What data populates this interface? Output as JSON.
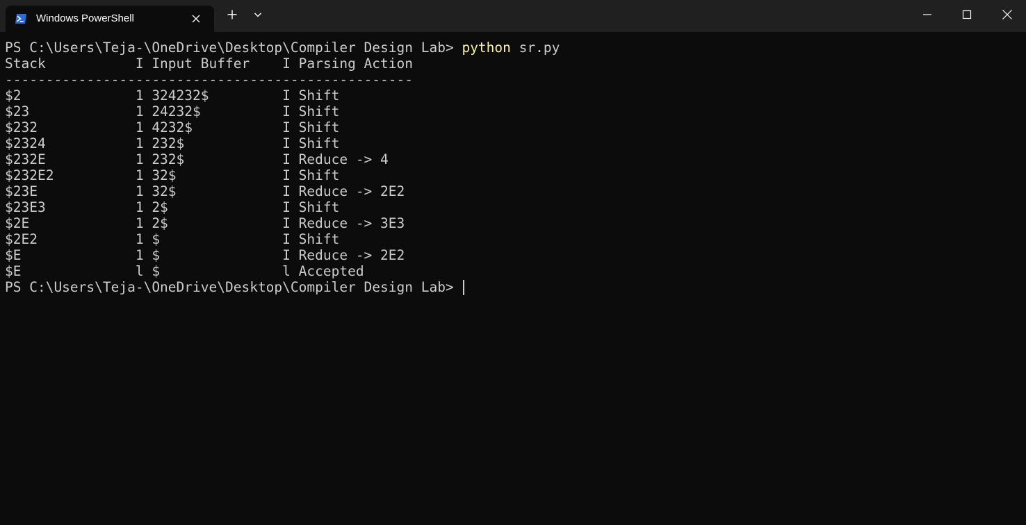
{
  "tab": {
    "title": "Windows PowerShell",
    "icon": "powershell-icon"
  },
  "titlebar": {
    "new_tab": "+",
    "icons": [
      "powershell-icon",
      "close-icon",
      "plus-icon",
      "chevron-down-icon",
      "minimize-icon",
      "maximize-icon",
      "close-icon"
    ]
  },
  "colors": {
    "background": "#0c0c0c",
    "titlebar": "#202020",
    "text": "#cccccc",
    "command": "#f9f1a5"
  },
  "terminal": {
    "prompt": "PS C:\\Users\\Teja-\\OneDrive\\Desktop\\Compiler Design Lab> ",
    "command_name": "python",
    "command_args": " sr.py",
    "header": "Stack           I Input Buffer    I Parsing Action",
    "separator": "--------------------------------------------------",
    "rows": [
      "$2              1 324232$         I Shift",
      "$23             1 24232$          I Shift",
      "$232            1 4232$           I Shift",
      "$2324           1 232$            I Shift",
      "$232E           1 232$            I Reduce -> 4",
      "$232E2          1 32$             I Shift",
      "$23E            1 32$             I Reduce -> 2E2",
      "$23E3           1 2$              I Shift",
      "$2E             1 2$              I Reduce -> 3E3",
      "$2E2            1 $               I Shift",
      "$E              1 $               I Reduce -> 2E2",
      "$E              l $               l Accepted"
    ],
    "final_prompt": "PS C:\\Users\\Teja-\\OneDrive\\Desktop\\Compiler Design Lab> "
  }
}
